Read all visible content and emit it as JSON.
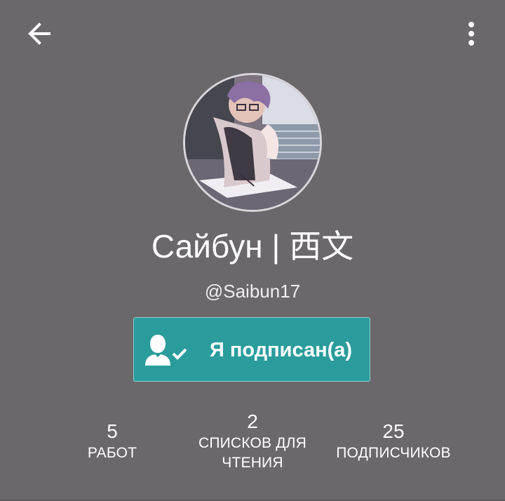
{
  "header": {
    "back_icon": "arrow-left-icon",
    "menu_icon": "more-vertical-icon"
  },
  "profile": {
    "display_name": "Сайбун | 西文",
    "handle": "@Saibun17",
    "avatar": "user-avatar-image"
  },
  "follow_button": {
    "label": "Я подписан(а)",
    "icon": "user-check-icon",
    "color": "#2b9c9c"
  },
  "stats": [
    {
      "count": "5",
      "label": "РАБОТ"
    },
    {
      "count": "2",
      "label": "СПИСКОВ ДЛЯ ЧТЕНИЯ"
    },
    {
      "count": "25",
      "label": "ПОДПИСЧИКОВ"
    }
  ],
  "colors": {
    "background": "#6a686b",
    "accent": "#2b9c9c"
  }
}
